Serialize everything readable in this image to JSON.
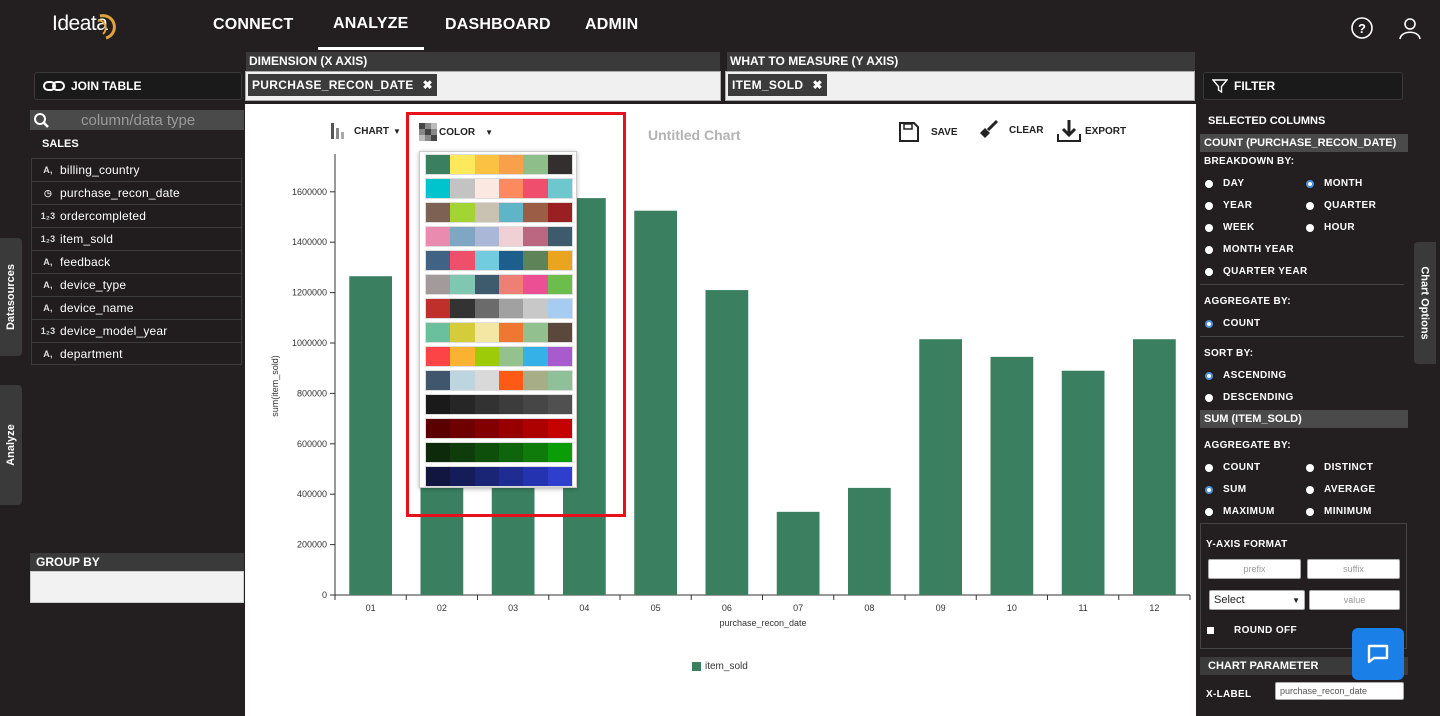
{
  "app": {
    "logo": "Ideata"
  },
  "nav": {
    "items": [
      "CONNECT",
      "ANALYZE",
      "DASHBOARD",
      "ADMIN"
    ],
    "active": "ANALYZE"
  },
  "left": {
    "join_table": "JOIN TABLE",
    "search_placeholder": "column/data type",
    "section": "SALES",
    "fields": [
      {
        "name": "billing_country",
        "type": "text-icon"
      },
      {
        "name": "purchase_recon_date",
        "type": "clock-icon"
      },
      {
        "name": "ordercompleted",
        "type": "number-icon"
      },
      {
        "name": "item_sold",
        "type": "number-icon"
      },
      {
        "name": "feedback",
        "type": "text-icon"
      },
      {
        "name": "device_type",
        "type": "text-icon"
      },
      {
        "name": "device_name",
        "type": "text-icon"
      },
      {
        "name": "device_model_year",
        "type": "number-icon"
      },
      {
        "name": "department",
        "type": "text-icon"
      }
    ],
    "tab_datasources": "Datasources",
    "tab_analyze": "Analyze",
    "group_by": "GROUP BY"
  },
  "dimension": {
    "header": "DIMENSION (X AXIS)",
    "chip": "PURCHASE_RECON_DATE"
  },
  "measure": {
    "header": "WHAT TO MEASURE (Y AXIS)",
    "chip": "ITEM_SOLD"
  },
  "toolbar": {
    "chart": "CHART",
    "color": "COLOR",
    "title": "Untitled Chart",
    "save": "SAVE",
    "clear": "CLEAR",
    "export": "EXPORT"
  },
  "chart_data": {
    "type": "bar",
    "title": "Untitled Chart",
    "xlabel": "purchase_recon_date",
    "ylabel": "sum(item_sold)",
    "categories": [
      "01",
      "02",
      "03",
      "04",
      "05",
      "06",
      "07",
      "08",
      "09",
      "10",
      "11",
      "12"
    ],
    "series": [
      {
        "name": "item_sold",
        "color": "#3a8060",
        "values": [
          1265000,
          1045000,
          1050000,
          1575000,
          1525000,
          1210000,
          330000,
          425000,
          1015000,
          945000,
          890000,
          1015000
        ]
      }
    ],
    "ylim": [
      0,
      1750000
    ],
    "yticks": [
      0,
      200000,
      400000,
      600000,
      800000,
      1000000,
      1200000,
      1400000,
      1600000
    ],
    "legend": "bottom",
    "grid": false
  },
  "palettes": [
    [
      "#3a8060",
      "#fde95b",
      "#fbc140",
      "#f9a14a",
      "#8ebf8a",
      "#332f2f"
    ],
    [
      "#00c4cd",
      "#c3c3c3",
      "#fbe8e0",
      "#fd8a5f",
      "#ef4f6d",
      "#6cc8cc"
    ],
    [
      "#7d6152",
      "#a2d534",
      "#c9c2b2",
      "#5fb5c8",
      "#9c5d47",
      "#9a1f22"
    ],
    [
      "#e98aaf",
      "#7fa7c3",
      "#aab7d6",
      "#f1d0d5",
      "#bb6782",
      "#3e5b6d"
    ],
    [
      "#3f6285",
      "#ee4f6a",
      "#71cce0",
      "#1c5f8d",
      "#5f8359",
      "#e9a51f"
    ],
    [
      "#a29a9b",
      "#7fc7b0",
      "#3e5b6d",
      "#ee7f74",
      "#ec4f93",
      "#6bbd4c"
    ],
    [
      "#c0302a",
      "#333333",
      "#6b6b6b",
      "#a1a1a1",
      "#c8c8c8",
      "#a6ccf2"
    ],
    [
      "#6ac09c",
      "#d5cc3b",
      "#f4e7a3",
      "#f07731",
      "#92c08e",
      "#59483b"
    ],
    [
      "#fc4346",
      "#fbb132",
      "#9dcb07",
      "#95c18f",
      "#36b1e8",
      "#a75bcd"
    ],
    [
      "#40566c",
      "#bdd5df",
      "#d9d9d9",
      "#fd5a16",
      "#a7ad87",
      "#8fc098"
    ],
    [
      "#1a1a1a",
      "#262626",
      "#323232",
      "#3c3c3c",
      "#464646",
      "#505050"
    ],
    [
      "#5b0000",
      "#6e0000",
      "#820000",
      "#980000",
      "#ad0000",
      "#c40000"
    ],
    [
      "#0d2b0a",
      "#0e3d0b",
      "#0f4f0c",
      "#0f650b",
      "#0e7b0b",
      "#0a9d08"
    ],
    [
      "#101640",
      "#141c5a",
      "#1a2575",
      "#1f2d93",
      "#2434b0",
      "#2d3fcc"
    ]
  ],
  "right": {
    "filter": "FILTER",
    "selected_columns": "SELECTED COLUMNS",
    "count_header": "COUNT (PURCHASE_RECON_DATE)",
    "breakdown_by": "BREAKDOWN BY:",
    "breakdown": [
      "DAY",
      "MONTH",
      "YEAR",
      "QUARTER",
      "WEEK",
      "HOUR",
      "MONTH YEAR",
      "QUARTER YEAR"
    ],
    "aggregate_by": "AGGREGATE BY:",
    "agg1": [
      "COUNT"
    ],
    "sort_by": "SORT BY:",
    "sort": [
      "ASCENDING",
      "DESCENDING"
    ],
    "sum_header": "SUM (ITEM_SOLD)",
    "aggregate_by2": "AGGREGATE BY:",
    "agg2": [
      "COUNT",
      "DISTINCT",
      "SUM",
      "AVERAGE",
      "MAXIMUM",
      "MINIMUM"
    ],
    "yaxis_format": "Y-AXIS FORMAT",
    "prefix": "prefix",
    "suffix": "suffix",
    "select": "Select",
    "value": "value",
    "round_off": "ROUND OFF",
    "chart_parameter": "CHART PARAMETER",
    "xlabel_label": "X-LABEL",
    "xlabel_value": "purchase_recon_date",
    "chart_options": "Chart Options"
  }
}
